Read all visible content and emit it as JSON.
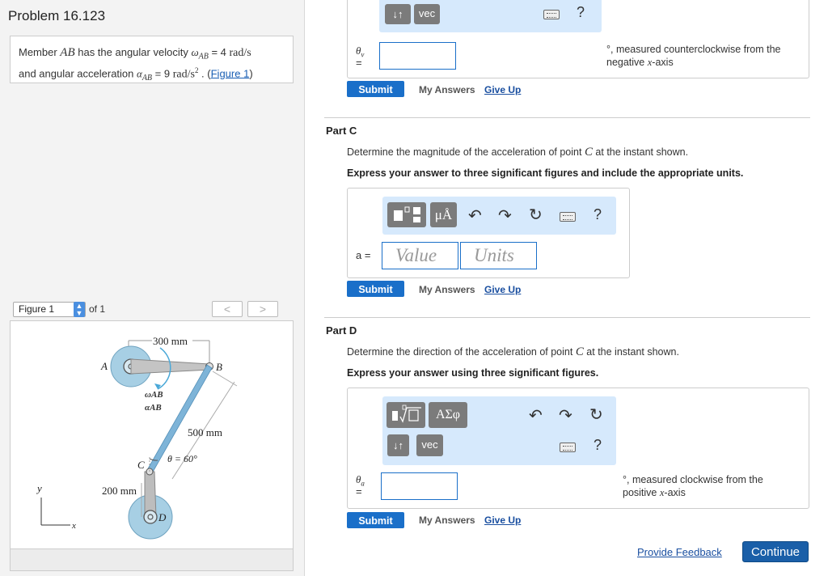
{
  "problem": {
    "title": "Problem 16.123",
    "statement_line1_prefix": "Member ",
    "member": "AB",
    "statement_line1_mid": " has the angular velocity ",
    "omega_symbol": "ω",
    "omega_sub": "AB",
    "omega_value": " = 4 ",
    "omega_unit": "rad/s",
    "statement_line2_prefix": "and angular acceleration ",
    "alpha_symbol": "α",
    "alpha_sub": "AB",
    "alpha_value": " = 9 ",
    "alpha_unit": "rad/s",
    "alpha_unit_exp": "2",
    "statement_line2_suffix": " . (",
    "figure_link": "Figure 1",
    "statement_close": ")"
  },
  "figure_nav": {
    "select_value": "Figure 1",
    "of_text": "of 1",
    "prev": "<",
    "next": ">"
  },
  "figure": {
    "label_A": "A",
    "label_B": "B",
    "label_C": "C",
    "label_D": "D",
    "dim_300": "300 mm",
    "dim_500": "500 mm",
    "dim_200": "200 mm",
    "omega_label": "ωAB",
    "alpha_label": "αAB",
    "theta_label": "θ = 60°",
    "axis_y": "y",
    "axis_x": "x"
  },
  "part_b": {
    "toolbar": {
      "arrows": "↓↑",
      "vec": "vec",
      "help": "?"
    },
    "var_symbol": "θ",
    "var_sub": "v",
    "equals": "=",
    "note_line1": "°, measured counterclockwise from the",
    "note_line2_prefix": "negative ",
    "note_axis": "x",
    "note_line2_suffix": "-axis",
    "submit": "Submit",
    "my_answers": "My Answers",
    "give_up": "Give Up"
  },
  "part_c": {
    "title": "Part C",
    "desc_prefix": "Determine the magnitude of the acceleration of point ",
    "desc_point": "C",
    "desc_suffix": " at the instant shown.",
    "instruction": "Express your answer to three significant figures and include the appropriate units.",
    "toolbar": {
      "mu": "μÅ",
      "help": "?"
    },
    "var_label": "a =",
    "value_placeholder": "Value",
    "units_placeholder": "Units",
    "submit": "Submit",
    "my_answers": "My Answers",
    "give_up": "Give Up"
  },
  "part_d": {
    "title": "Part D",
    "desc_prefix": "Determine the direction of the acceleration of point ",
    "desc_point": "C",
    "desc_suffix": " at the instant shown.",
    "instruction": "Express your answer using three significant figures.",
    "toolbar": {
      "greek": "ΑΣφ",
      "arrows": "↓↑",
      "vec": "vec",
      "help": "?"
    },
    "var_symbol": "θ",
    "var_sub": "a",
    "equals": "=",
    "note_line1": "°, measured clockwise from the",
    "note_line2_prefix": "positive ",
    "note_axis": "x",
    "note_line2_suffix": "-axis",
    "submit": "Submit",
    "my_answers": "My Answers",
    "give_up": "Give Up"
  },
  "footer": {
    "feedback": "Provide Feedback",
    "continue": "Continue"
  }
}
